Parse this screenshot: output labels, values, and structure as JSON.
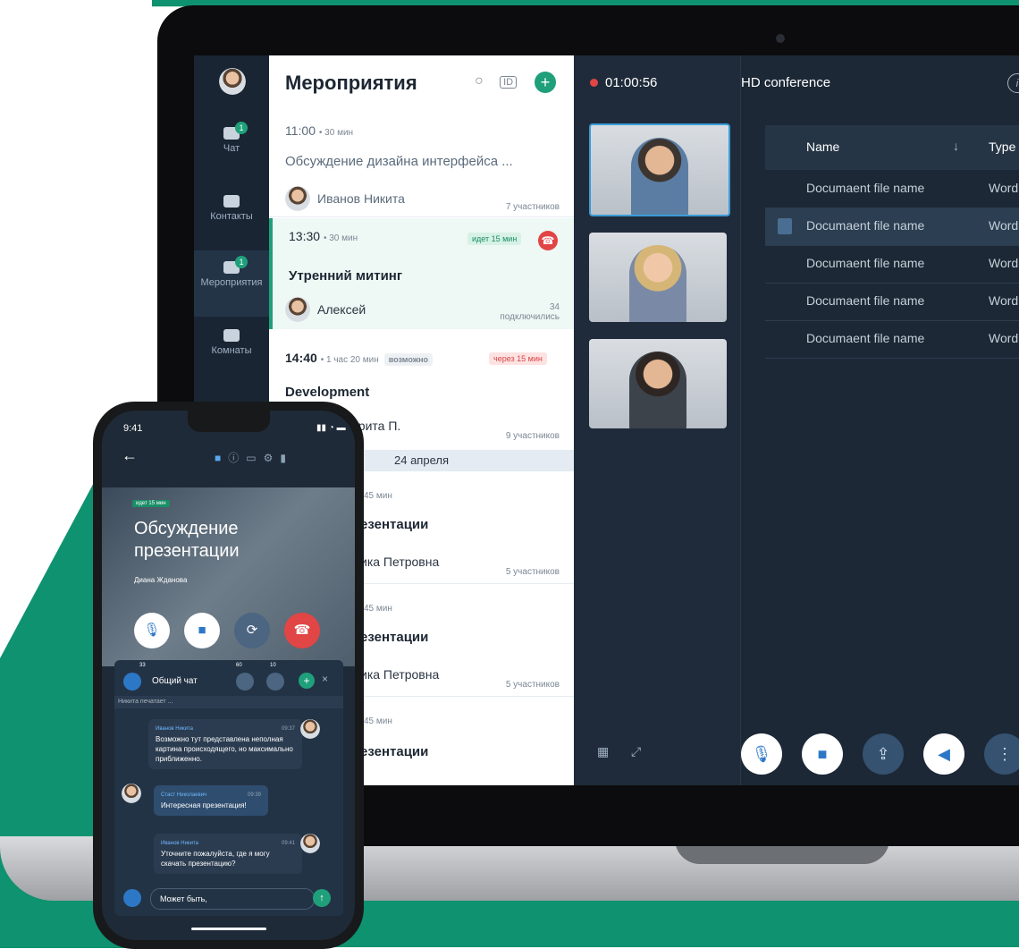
{
  "sidebar": {
    "items": [
      {
        "label": "Чат",
        "badge": "1"
      },
      {
        "label": "Контакты",
        "badge": ""
      },
      {
        "label": "Мероприятия",
        "badge": "1"
      },
      {
        "label": "Комнаты",
        "badge": ""
      }
    ]
  },
  "events": {
    "title": "Мероприятия",
    "date_separator": "24 апреля",
    "list": [
      {
        "time": "11:00",
        "duration": "• 30 мин",
        "name": "Обсуждение дизайна интерфейса ...",
        "host": "Иванов Никита",
        "participants": "7 участников"
      },
      {
        "time": "13:30",
        "duration": "• 30 мин",
        "status": "идет 15 мин",
        "name": "Утренний митинг",
        "host": "Алексей",
        "participants_count": "34",
        "participants_label": "подключились"
      },
      {
        "time": "14:40",
        "duration": "• 1 час 20 мин",
        "tag1": "возможно",
        "tag2": "через 15 мин",
        "name": "Development",
        "host": "арита П.",
        "participants": "9 участников"
      },
      {
        "duration": "45 мин",
        "name": "езентации",
        "host": "ика Петровна",
        "participants": "5 участников"
      },
      {
        "duration": "45 мин",
        "name": "езентации",
        "host": "ика Петровна",
        "participants": "5 участников"
      },
      {
        "duration": "45 мин",
        "name": "езентации"
      }
    ]
  },
  "call": {
    "timer": "01:00:56"
  },
  "conference": {
    "title": "HD conference",
    "info_icon": "i",
    "columns": {
      "name": "Name",
      "type": "Type"
    },
    "rows": [
      {
        "name": "Documaent file name",
        "type": "Word"
      },
      {
        "name": "Documaent file name",
        "type": "Word"
      },
      {
        "name": "Documaent file name",
        "type": "Word"
      },
      {
        "name": "Documaent file name",
        "type": "Word"
      },
      {
        "name": "Documaent file name",
        "type": "Word"
      }
    ]
  },
  "phone": {
    "time": "9:41",
    "status_tag": "идет 15 мин",
    "meeting_title": "Обсуждение презентации",
    "host": "Диана Жданова",
    "chat": {
      "title": "Общий чат",
      "counts": [
        "33",
        "60",
        "10"
      ],
      "typing": "Никита печатает ...",
      "messages": [
        {
          "from": "Иванов Никита",
          "time": "09:37",
          "text": "Возможно тут представлена неполная картина происходящего, но максимально приближенно."
        },
        {
          "from": "Стаст Николаевич",
          "time": "09:39",
          "text": "Интересная презентация!"
        },
        {
          "from": "Иванов Никита",
          "time": "09:41",
          "text": "Уточните пожалуйста, где я могу скачать презентацию?"
        }
      ],
      "input_value": "Может быть,"
    }
  },
  "colors": {
    "brand_green": "#0e9270",
    "end_call_red": "#e14545",
    "accent_blue": "#2c78c7"
  }
}
